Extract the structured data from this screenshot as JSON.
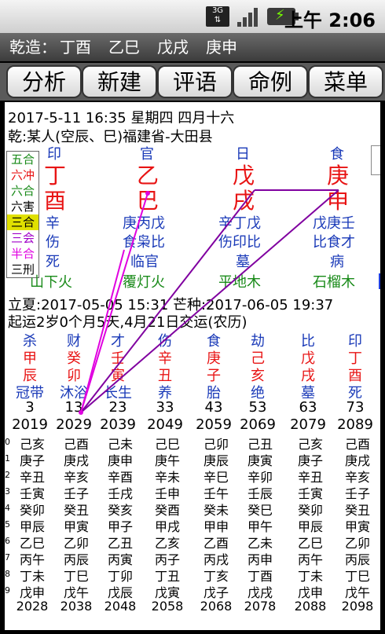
{
  "status_bar": {
    "network": "3G",
    "time": "上午 2:06"
  },
  "title_bar": {
    "label": "乾造：",
    "pillars": [
      "丁酉",
      "乙巳",
      "戊戌",
      "庚申"
    ]
  },
  "toolbar": {
    "buttons": [
      "分析",
      "新建",
      "评语",
      "命例",
      "菜单"
    ]
  },
  "info": {
    "line1": "2017-5-11 16:35  星期四  四月十六",
    "line2": "乾:某人(空辰、巳)福建省-大田县"
  },
  "legend": [
    {
      "text": "五合",
      "color": "#188a18"
    },
    {
      "text": "六冲",
      "color": "#e81414"
    },
    {
      "text": "六合",
      "color": "#188a18"
    },
    {
      "text": "六害",
      "color": "#000000"
    },
    {
      "text": "三合",
      "color": "#e0e000"
    },
    {
      "text": "三会",
      "color": "#a000c8"
    },
    {
      "text": "半合",
      "color": "#e000e0"
    },
    {
      "text": "三刑",
      "color": "#000000"
    }
  ],
  "pillars": [
    {
      "god": "印",
      "stem": "丁",
      "branch": "酉",
      "hidden": "辛",
      "hidden_gods": "伤",
      "stage": "死",
      "nayin": "山下火"
    },
    {
      "god": "官",
      "stem": "乙",
      "branch": "巳",
      "hidden": "庚丙戊",
      "hidden_gods": "食枭比",
      "stage": "临官",
      "nayin": "覆灯火"
    },
    {
      "god": "日",
      "stem": "戊",
      "branch": "戌",
      "hidden": "辛丁戊",
      "hidden_gods": "伤印比",
      "stage": "墓",
      "nayin": "平地木"
    },
    {
      "god": "食",
      "stem": "庚",
      "branch": "申",
      "hidden": "戊庚壬",
      "hidden_gods": "比食才",
      "stage": "病",
      "nayin": "石榴木"
    }
  ],
  "jieqi": {
    "line1": "立夏:2017-05-05 15:31  芒种:2017-06-05 19:37",
    "line2": "起运2岁0个月5天,4月21日交运(农历)"
  },
  "dayun": {
    "gods": [
      "杀",
      "财",
      "才",
      "伤",
      "食",
      "劫",
      "比",
      "印"
    ],
    "stems": [
      "甲",
      "癸",
      "壬",
      "辛",
      "庚",
      "己",
      "戊",
      "丁"
    ],
    "branches": [
      "辰",
      "卯",
      "寅",
      "丑",
      "子",
      "亥",
      "戌",
      "酉"
    ],
    "stages": [
      "冠带",
      "沐浴",
      "长生",
      "养",
      "胎",
      "绝",
      "墓",
      "死"
    ],
    "ages": [
      "3",
      "13",
      "23",
      "33",
      "43",
      "53",
      "63",
      "73"
    ],
    "years": [
      "2019",
      "2029",
      "2039",
      "2049",
      "2059",
      "2069",
      "2079",
      "2089"
    ]
  },
  "liunian": {
    "row_index": [
      "0",
      "1",
      "2",
      "3",
      "4",
      "5",
      "6",
      "7",
      "8",
      "9"
    ],
    "rows": [
      [
        "己亥",
        "己酉",
        "己未",
        "己巳",
        "己卯",
        "己丑",
        "己亥",
        "己酉"
      ],
      [
        "庚子",
        "庚戌",
        "庚申",
        "庚午",
        "庚辰",
        "庚寅",
        "庚子",
        "庚戌"
      ],
      [
        "辛丑",
        "辛亥",
        "辛酉",
        "辛未",
        "辛巳",
        "辛卯",
        "辛丑",
        "辛亥"
      ],
      [
        "壬寅",
        "壬子",
        "壬戌",
        "壬申",
        "壬午",
        "壬辰",
        "壬寅",
        "壬子"
      ],
      [
        "癸卯",
        "癸丑",
        "癸亥",
        "癸酉",
        "癸未",
        "癸巳",
        "癸卯",
        "癸丑"
      ],
      [
        "甲辰",
        "甲寅",
        "甲子",
        "甲戌",
        "甲申",
        "甲午",
        "甲辰",
        "甲寅"
      ],
      [
        "乙巳",
        "乙卯",
        "乙丑",
        "乙亥",
        "乙酉",
        "乙未",
        "乙巳",
        "乙卯"
      ],
      [
        "丙午",
        "丙辰",
        "丙寅",
        "丙子",
        "丙戌",
        "丙申",
        "丙午",
        "丙辰"
      ],
      [
        "丁未",
        "丁巳",
        "丁卯",
        "丁丑",
        "丁亥",
        "丁酉",
        "丁未",
        "丁巳"
      ],
      [
        "戊申",
        "戊午",
        "戊辰",
        "戊寅",
        "戊子",
        "戊戌",
        "戊申",
        "戊午"
      ]
    ],
    "end_years": [
      "2028",
      "2038",
      "2048",
      "2058",
      "2068",
      "2078",
      "2088",
      "2098"
    ]
  }
}
